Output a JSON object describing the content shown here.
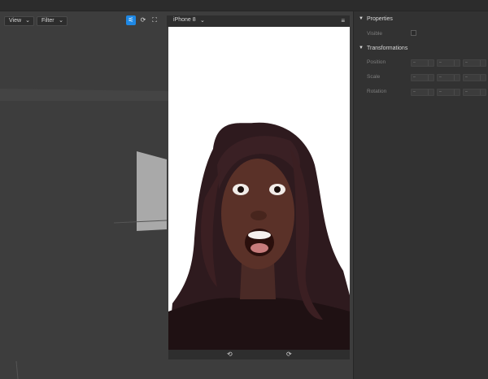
{
  "viewport": {
    "view_label": "View",
    "filter_label": "Filter"
  },
  "device": {
    "name": "iPhone 8",
    "chevron": "⌄",
    "menu_icon": "≡",
    "image": "surprised woman with mouth open"
  },
  "panel": {
    "properties": {
      "title": "Properties",
      "visible_label": "Visible"
    },
    "transformations": {
      "title": "Transformations",
      "rows": [
        {
          "label": "Position"
        },
        {
          "label": "Scale"
        },
        {
          "label": "Rotation"
        }
      ],
      "field_text": "–"
    }
  },
  "icons": {
    "manipulate": "⚟",
    "refresh": "⟳",
    "fit": "⛶",
    "apple": "",
    "rotate": "⟲",
    "rotate_lock": "⟳"
  },
  "colors": {
    "accent": "#1e88e5",
    "panel_bg": "#323232",
    "viewport_bg": "#3d3d3d"
  }
}
